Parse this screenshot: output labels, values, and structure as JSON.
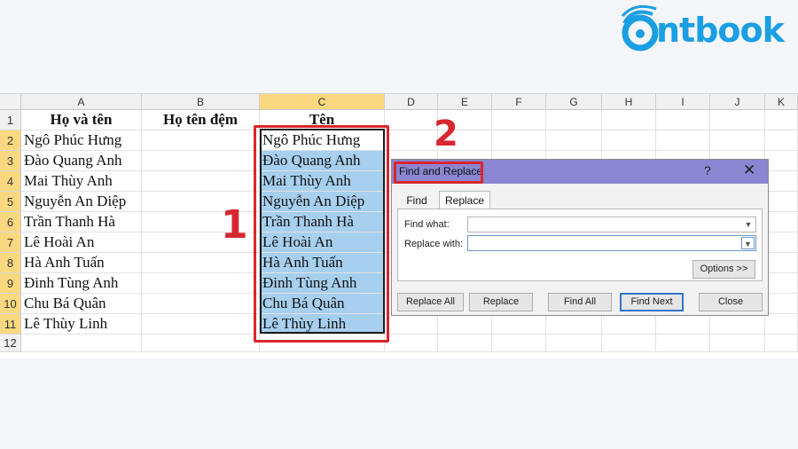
{
  "logo": {
    "text": "ntbook",
    "color": "#1a9fe3"
  },
  "sheet": {
    "columns": [
      "A",
      "B",
      "C",
      "D",
      "E",
      "F",
      "G",
      "H",
      "I",
      "J",
      "K"
    ],
    "rows": [
      "1",
      "2",
      "3",
      "4",
      "5",
      "6",
      "7",
      "8",
      "9",
      "10",
      "11",
      "12"
    ],
    "headers": {
      "a": "Họ và tên",
      "b": "Họ tên đệm",
      "c": "Tên"
    },
    "names": [
      "Ngô Phúc Hưng",
      "Đào Quang Anh",
      "Mai Thùy Anh",
      "Nguyễn An Diệp",
      "Trần Thanh Hà",
      "Lê Hoài An",
      "Hà Anh Tuấn",
      "Đinh Tùng Anh",
      "Chu Bá Quân",
      "Lê Thùy Linh"
    ],
    "selected_column": "C",
    "selection_color": "#a7cfee"
  },
  "annotations": {
    "step1": "1",
    "step2": "2",
    "color": "#d8262e"
  },
  "dialog": {
    "title": "Find and Replace",
    "help": "?",
    "close": "✕",
    "tabs": {
      "find": "Find",
      "replace": "Replace"
    },
    "active_tab": "Replace",
    "find_label": "Find what:",
    "replace_label": "Replace with:",
    "find_value": "",
    "replace_value": "",
    "buttons": {
      "options": "Options >>",
      "replace_all": "Replace All",
      "replace": "Replace",
      "find_all": "Find All",
      "find_next": "Find Next",
      "close": "Close"
    },
    "title_bar_color": "#8a86d2"
  }
}
